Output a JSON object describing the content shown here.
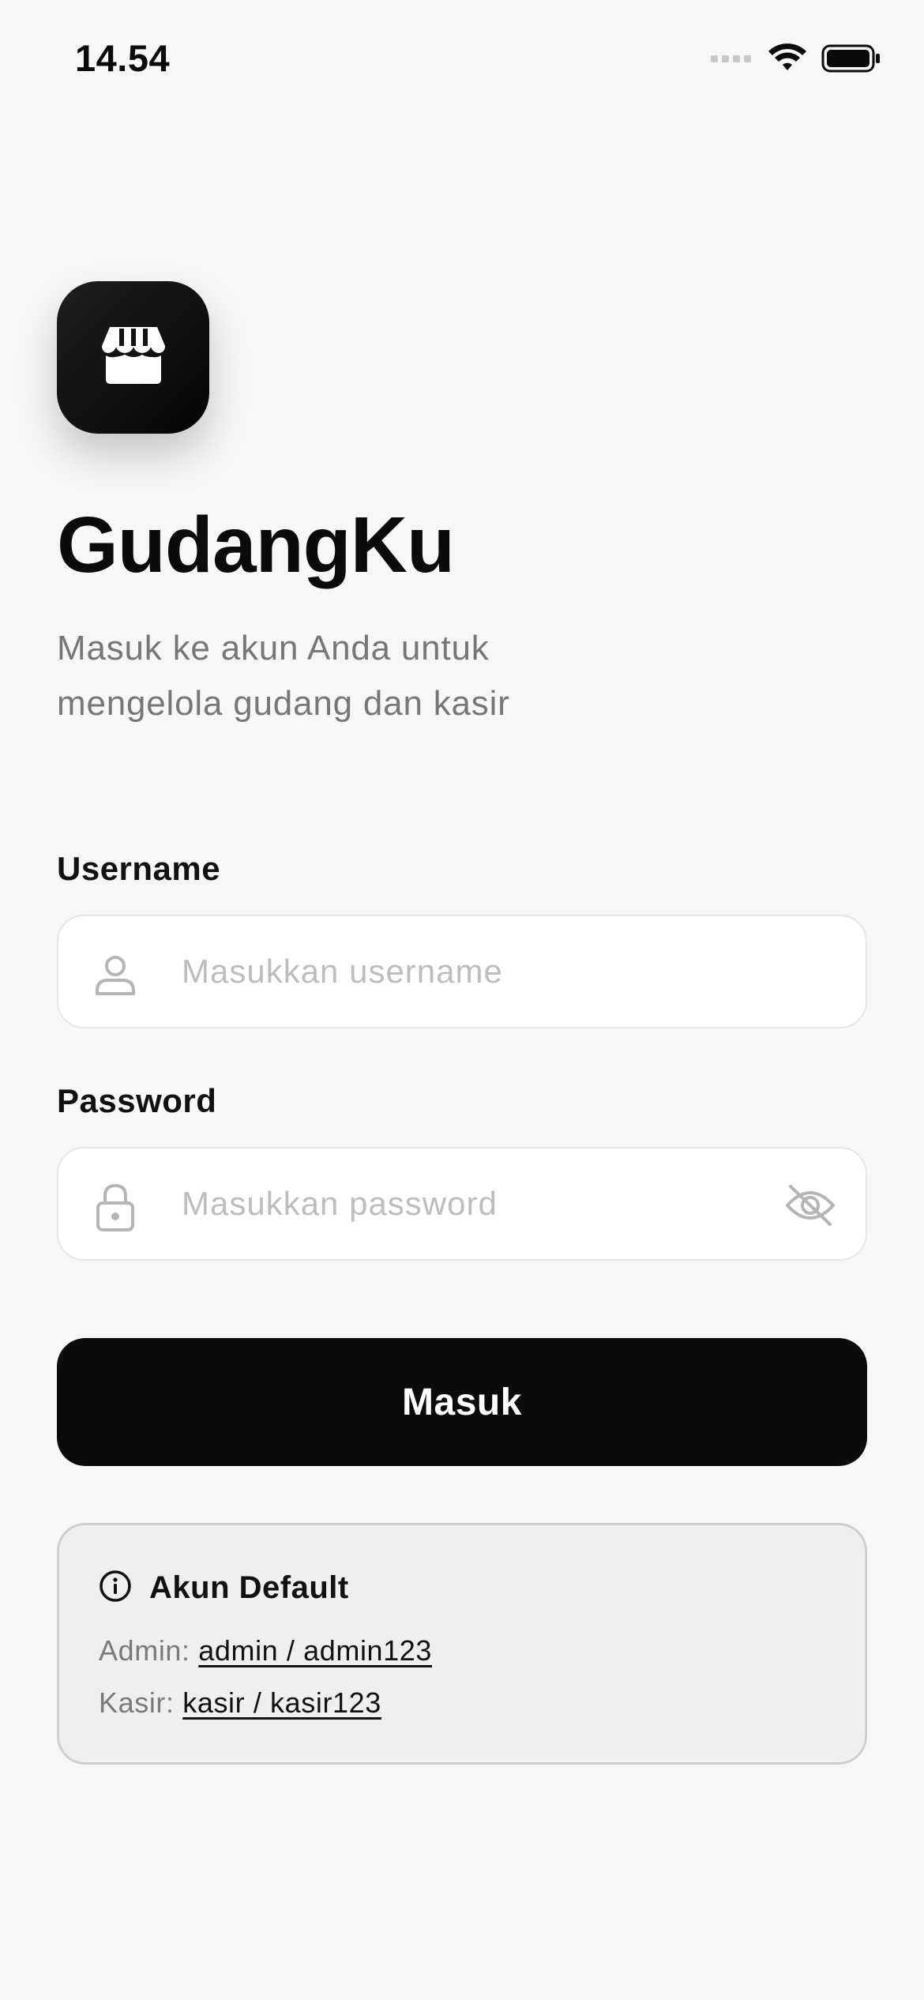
{
  "status_bar": {
    "time": "14.54",
    "icons": [
      "cellular-signal-icon",
      "wifi-icon",
      "battery-icon"
    ]
  },
  "app": {
    "logo_icon": "store-icon",
    "title": "GudangKu",
    "subtitle_line1": "Masuk ke akun Anda untuk",
    "subtitle_line2": "mengelola gudang dan kasir"
  },
  "form": {
    "username": {
      "label": "Username",
      "placeholder": "Masukkan username",
      "value": "",
      "icon": "user-icon"
    },
    "password": {
      "label": "Password",
      "placeholder": "Masukkan password",
      "value": "",
      "icon": "lock-icon",
      "toggle_icon": "eye-off-icon"
    },
    "submit_label": "Masuk"
  },
  "default_accounts": {
    "icon": "info-icon",
    "title": "Akun Default",
    "admin_label": "Admin:",
    "admin_credentials": "admin / admin123",
    "cashier_label": "Kasir:",
    "cashier_credentials": "kasir / kasir123"
  },
  "colors": {
    "background": "#f7f7f7",
    "primary": "#0b0b0b",
    "muted_text": "#777777",
    "placeholder": "#bdbdbd",
    "card_bg": "#efefef"
  }
}
